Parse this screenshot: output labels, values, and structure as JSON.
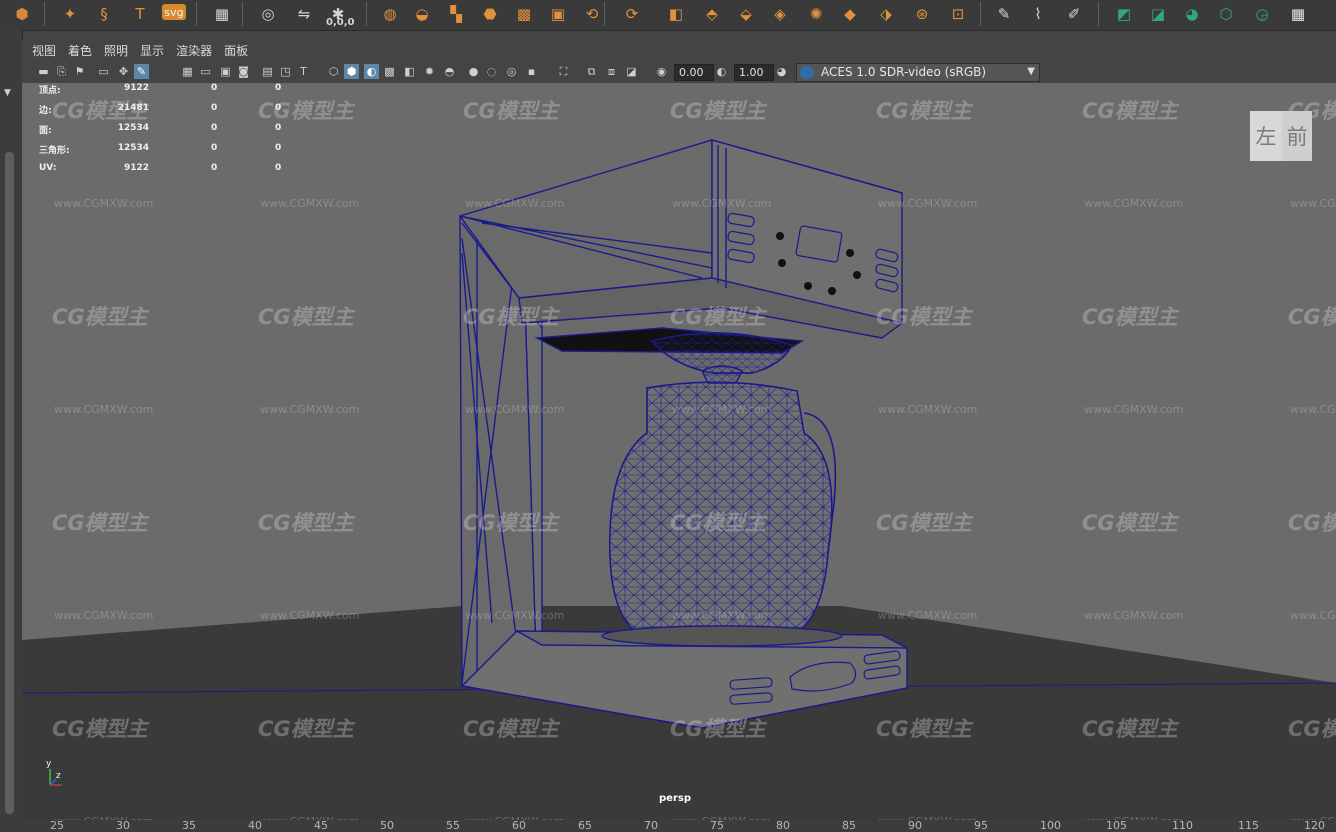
{
  "shelf": {
    "icons": [
      {
        "name": "poly-platonic-icon",
        "glyph": "⬢",
        "color": "#d9873a"
      },
      {
        "name": "poly-superellipse-icon",
        "glyph": "✦",
        "color": "#e0913a"
      },
      {
        "name": "poly-helix-icon",
        "glyph": "§",
        "color": "#e0913a"
      },
      {
        "name": "text-tool-icon",
        "glyph": "T",
        "color": "#e0913a"
      },
      {
        "name": "svg-tool-icon",
        "glyph": "svg",
        "color": "#f2f2f2"
      },
      {
        "name": "type-grid-icon",
        "glyph": "▦",
        "color": "#cfd6dc"
      },
      {
        "name": "sculpt-select-icon",
        "glyph": "◎",
        "color": "#cfd6dc"
      },
      {
        "name": "mirror-tool-icon",
        "glyph": "⇋",
        "color": "#cfd6dc"
      },
      {
        "name": "snap-origin-icon",
        "glyph": "✱",
        "color": "#cfd6dc"
      },
      {
        "name": "combine-icon",
        "glyph": "◍",
        "color": "#e0913a"
      },
      {
        "name": "separate-icon",
        "glyph": "◒",
        "color": "#e0913a"
      },
      {
        "name": "extract-icon",
        "glyph": "▚",
        "color": "#e0913a"
      },
      {
        "name": "smooth-icon",
        "glyph": "⬣",
        "color": "#e0913a"
      },
      {
        "name": "boolean-icon",
        "glyph": "▩",
        "color": "#e0913a"
      },
      {
        "name": "fill-hole-icon",
        "glyph": "▣",
        "color": "#e0913a"
      },
      {
        "name": "reduce-icon",
        "glyph": "⟲",
        "color": "#e0913a"
      },
      {
        "name": "remesh-icon",
        "glyph": "⟳",
        "color": "#e0913a"
      },
      {
        "name": "extrude-icon",
        "glyph": "◧",
        "color": "#e0913a"
      },
      {
        "name": "bridge-icon",
        "glyph": "⬘",
        "color": "#e0913a"
      },
      {
        "name": "bevel-icon",
        "glyph": "⬙",
        "color": "#e0913a"
      },
      {
        "name": "merge-icon",
        "glyph": "◈",
        "color": "#e0913a"
      },
      {
        "name": "target-weld-icon",
        "glyph": "✺",
        "color": "#e0913a"
      },
      {
        "name": "poke-icon",
        "glyph": "◆",
        "color": "#e0913a"
      },
      {
        "name": "wedge-icon",
        "glyph": "⬗",
        "color": "#e0913a"
      },
      {
        "name": "circularize-icon",
        "glyph": "⊛",
        "color": "#e0913a"
      },
      {
        "name": "collapse-icon",
        "glyph": "⊡",
        "color": "#e0913a"
      },
      {
        "name": "connect-icon",
        "glyph": "✎",
        "color": "#cfd6dc"
      },
      {
        "name": "knife-icon",
        "glyph": "⌇",
        "color": "#cfd6dc"
      },
      {
        "name": "multi-cut-icon",
        "glyph": "✐",
        "color": "#cfd6dc"
      },
      {
        "name": "uv-planar-icon",
        "glyph": "◩",
        "color": "#2fa87e"
      },
      {
        "name": "uv-cylindrical-icon",
        "glyph": "◪",
        "color": "#2fa87e"
      },
      {
        "name": "uv-spherical-icon",
        "glyph": "◕",
        "color": "#2fa87e"
      },
      {
        "name": "uv-auto-icon",
        "glyph": "⬡",
        "color": "#2fa87e"
      },
      {
        "name": "uv-camera-icon",
        "glyph": "◶",
        "color": "#2fa87e"
      },
      {
        "name": "uv-editor-icon",
        "glyph": "▦",
        "color": "#e6e6e6"
      }
    ],
    "snap_label": "0,0,0"
  },
  "menu": {
    "items": [
      "视图",
      "着色",
      "照明",
      "显示",
      "渲染器",
      "面板"
    ]
  },
  "toolbar": {
    "exposure_value": "0.00",
    "gamma_value": "1.00",
    "color_space": "ACES 1.0 SDR-video (sRGB)",
    "icons": [
      "select-camera-icon",
      "camera-attributes-icon",
      "bookmark-icon",
      "image-plane-icon",
      "2d-pan-zoom-icon",
      "grease-pencil-icon",
      "grid-icon",
      "film-gate-icon",
      "resolution-gate-icon",
      "gate-mask-icon",
      "field-chart-icon",
      "safe-action-icon",
      "safe-title-icon",
      "wireframe-icon",
      "smooth-shade-icon",
      "use-default-material-icon",
      "wireframe-on-shaded-icon",
      "xray-icon",
      "lights-icon",
      "shadows-icon",
      "screen-space-ao-icon",
      "motion-blur-icon",
      "multisample-aa-icon",
      "depth-of-field-icon",
      "isolate-select-icon",
      "xray-joints-icon",
      "xray-active-icon",
      "backface-culling-icon",
      "exposure-icon",
      "gamma-icon",
      "color-management-icon"
    ]
  },
  "hud": {
    "rows": [
      {
        "label": "顶点:",
        "v1": "9122",
        "v2": "0",
        "v3": "0"
      },
      {
        "label": "边:",
        "v1": "21481",
        "v2": "0",
        "v3": "0"
      },
      {
        "label": "面:",
        "v1": "12534",
        "v2": "0",
        "v3": "0"
      },
      {
        "label": "三角形:",
        "v1": "12534",
        "v2": "0",
        "v3": "0"
      },
      {
        "label": "UV:",
        "v1": "9122",
        "v2": "0",
        "v3": "0"
      }
    ]
  },
  "viewport": {
    "camera": "persp",
    "viewcube_left": "左",
    "viewcube_front": "前",
    "watermark": "CG模型主",
    "watermark_url": "www.CGMXW.com",
    "axis_y": "y",
    "axis_z": "z"
  },
  "timeline": {
    "ticks": [
      "25",
      "30",
      "35",
      "40",
      "45",
      "50",
      "55",
      "60",
      "65",
      "70",
      "75",
      "80",
      "85",
      "90",
      "95",
      "100",
      "105",
      "110",
      "115",
      "120"
    ]
  },
  "colors": {
    "wire": "#1a1a8c",
    "viewport_bg": "#6b6b6b",
    "floor": "#3a3a3a",
    "accent_orange": "#e0913a",
    "accent_green": "#2fa87e"
  }
}
